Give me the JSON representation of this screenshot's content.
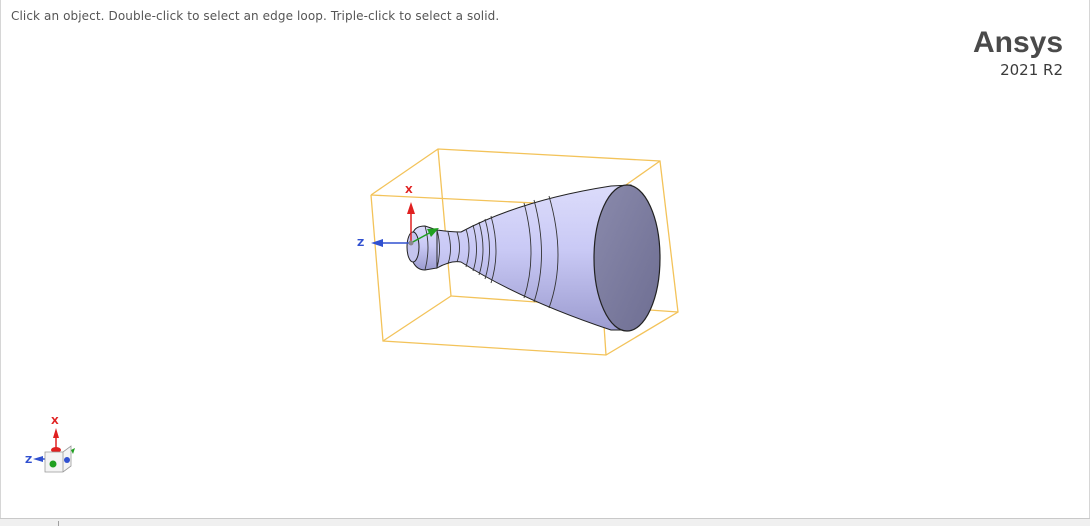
{
  "viewport": {
    "hint": "Click an object. Double-click to select an edge loop. Triple-click to select a solid."
  },
  "brand": {
    "name": "Ansys",
    "version": "2021 R2"
  },
  "model_triad": {
    "x_label": "X",
    "z_label": "Z"
  },
  "view_triad": {
    "x_label": "X",
    "z_label": "Z"
  },
  "colors": {
    "bounding_box": "#f3c35a",
    "body_fill": "#c8c8f4",
    "body_face": "#7b7b9c",
    "x_axis": "#e02020",
    "y_axis": "#20a020",
    "z_axis": "#3050d0"
  }
}
